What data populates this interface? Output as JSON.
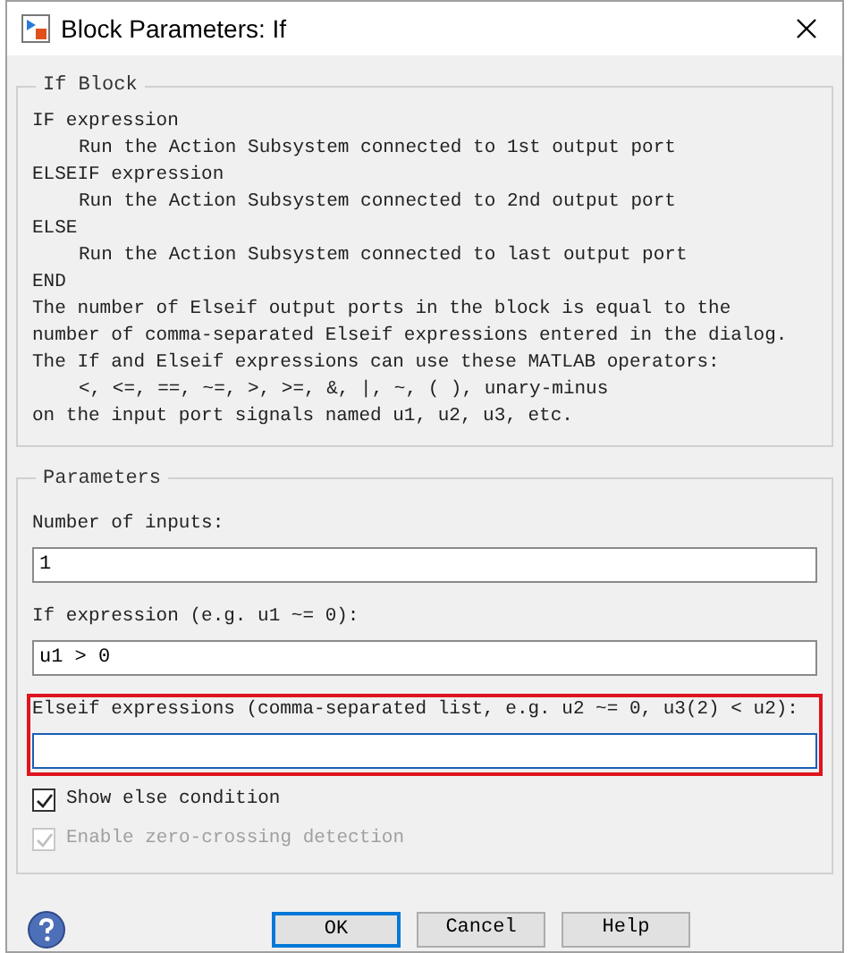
{
  "window": {
    "title": "Block Parameters: If"
  },
  "description": {
    "legend": "If Block",
    "lines": [
      {
        "text": "IF expression",
        "indented": false
      },
      {
        "text": "Run the Action Subsystem connected to 1st output port",
        "indented": true
      },
      {
        "text": "ELSEIF expression",
        "indented": false
      },
      {
        "text": "Run the Action Subsystem connected to 2nd output port",
        "indented": true
      },
      {
        "text": "ELSE",
        "indented": false
      },
      {
        "text": "Run the Action Subsystem connected to last output port",
        "indented": true
      },
      {
        "text": "END",
        "indented": false
      },
      {
        "text": "The number of Elseif output ports in the block is equal to the",
        "indented": false
      },
      {
        "text": "number of comma-separated Elseif expressions entered in the dialog.",
        "indented": false
      },
      {
        "text": "The If and Elseif expressions can use these MATLAB operators:",
        "indented": false
      },
      {
        "text": "<, <=, ==, ~=, >, >=, &, |, ~, ( ), unary-minus",
        "indented": true
      },
      {
        "text": "on the input port signals named u1, u2, u3, etc.",
        "indented": false
      }
    ]
  },
  "parameters": {
    "legend": "Parameters",
    "fields": [
      {
        "label": "Number of inputs:",
        "value": "1",
        "highlighted": false,
        "focused": false
      },
      {
        "label": "If expression (e.g. u1 ~= 0):",
        "value": "u1 > 0",
        "highlighted": false,
        "focused": false
      },
      {
        "label": "Elseif expressions (comma-separated list, e.g. u2 ~= 0, u3(2) < u2):",
        "highlighted": true,
        "focused": true
      }
    ],
    "checkboxes": [
      {
        "label": "Show else condition",
        "checked": true,
        "disabled": false
      },
      {
        "label": "Enable zero-crossing detection",
        "checked": true,
        "disabled": true
      }
    ]
  },
  "buttons": [
    {
      "label": "OK",
      "default": true,
      "disabled": false
    },
    {
      "label": "Cancel",
      "default": false,
      "disabled": false
    },
    {
      "label": "Help",
      "default": false,
      "disabled": false
    }
  ]
}
